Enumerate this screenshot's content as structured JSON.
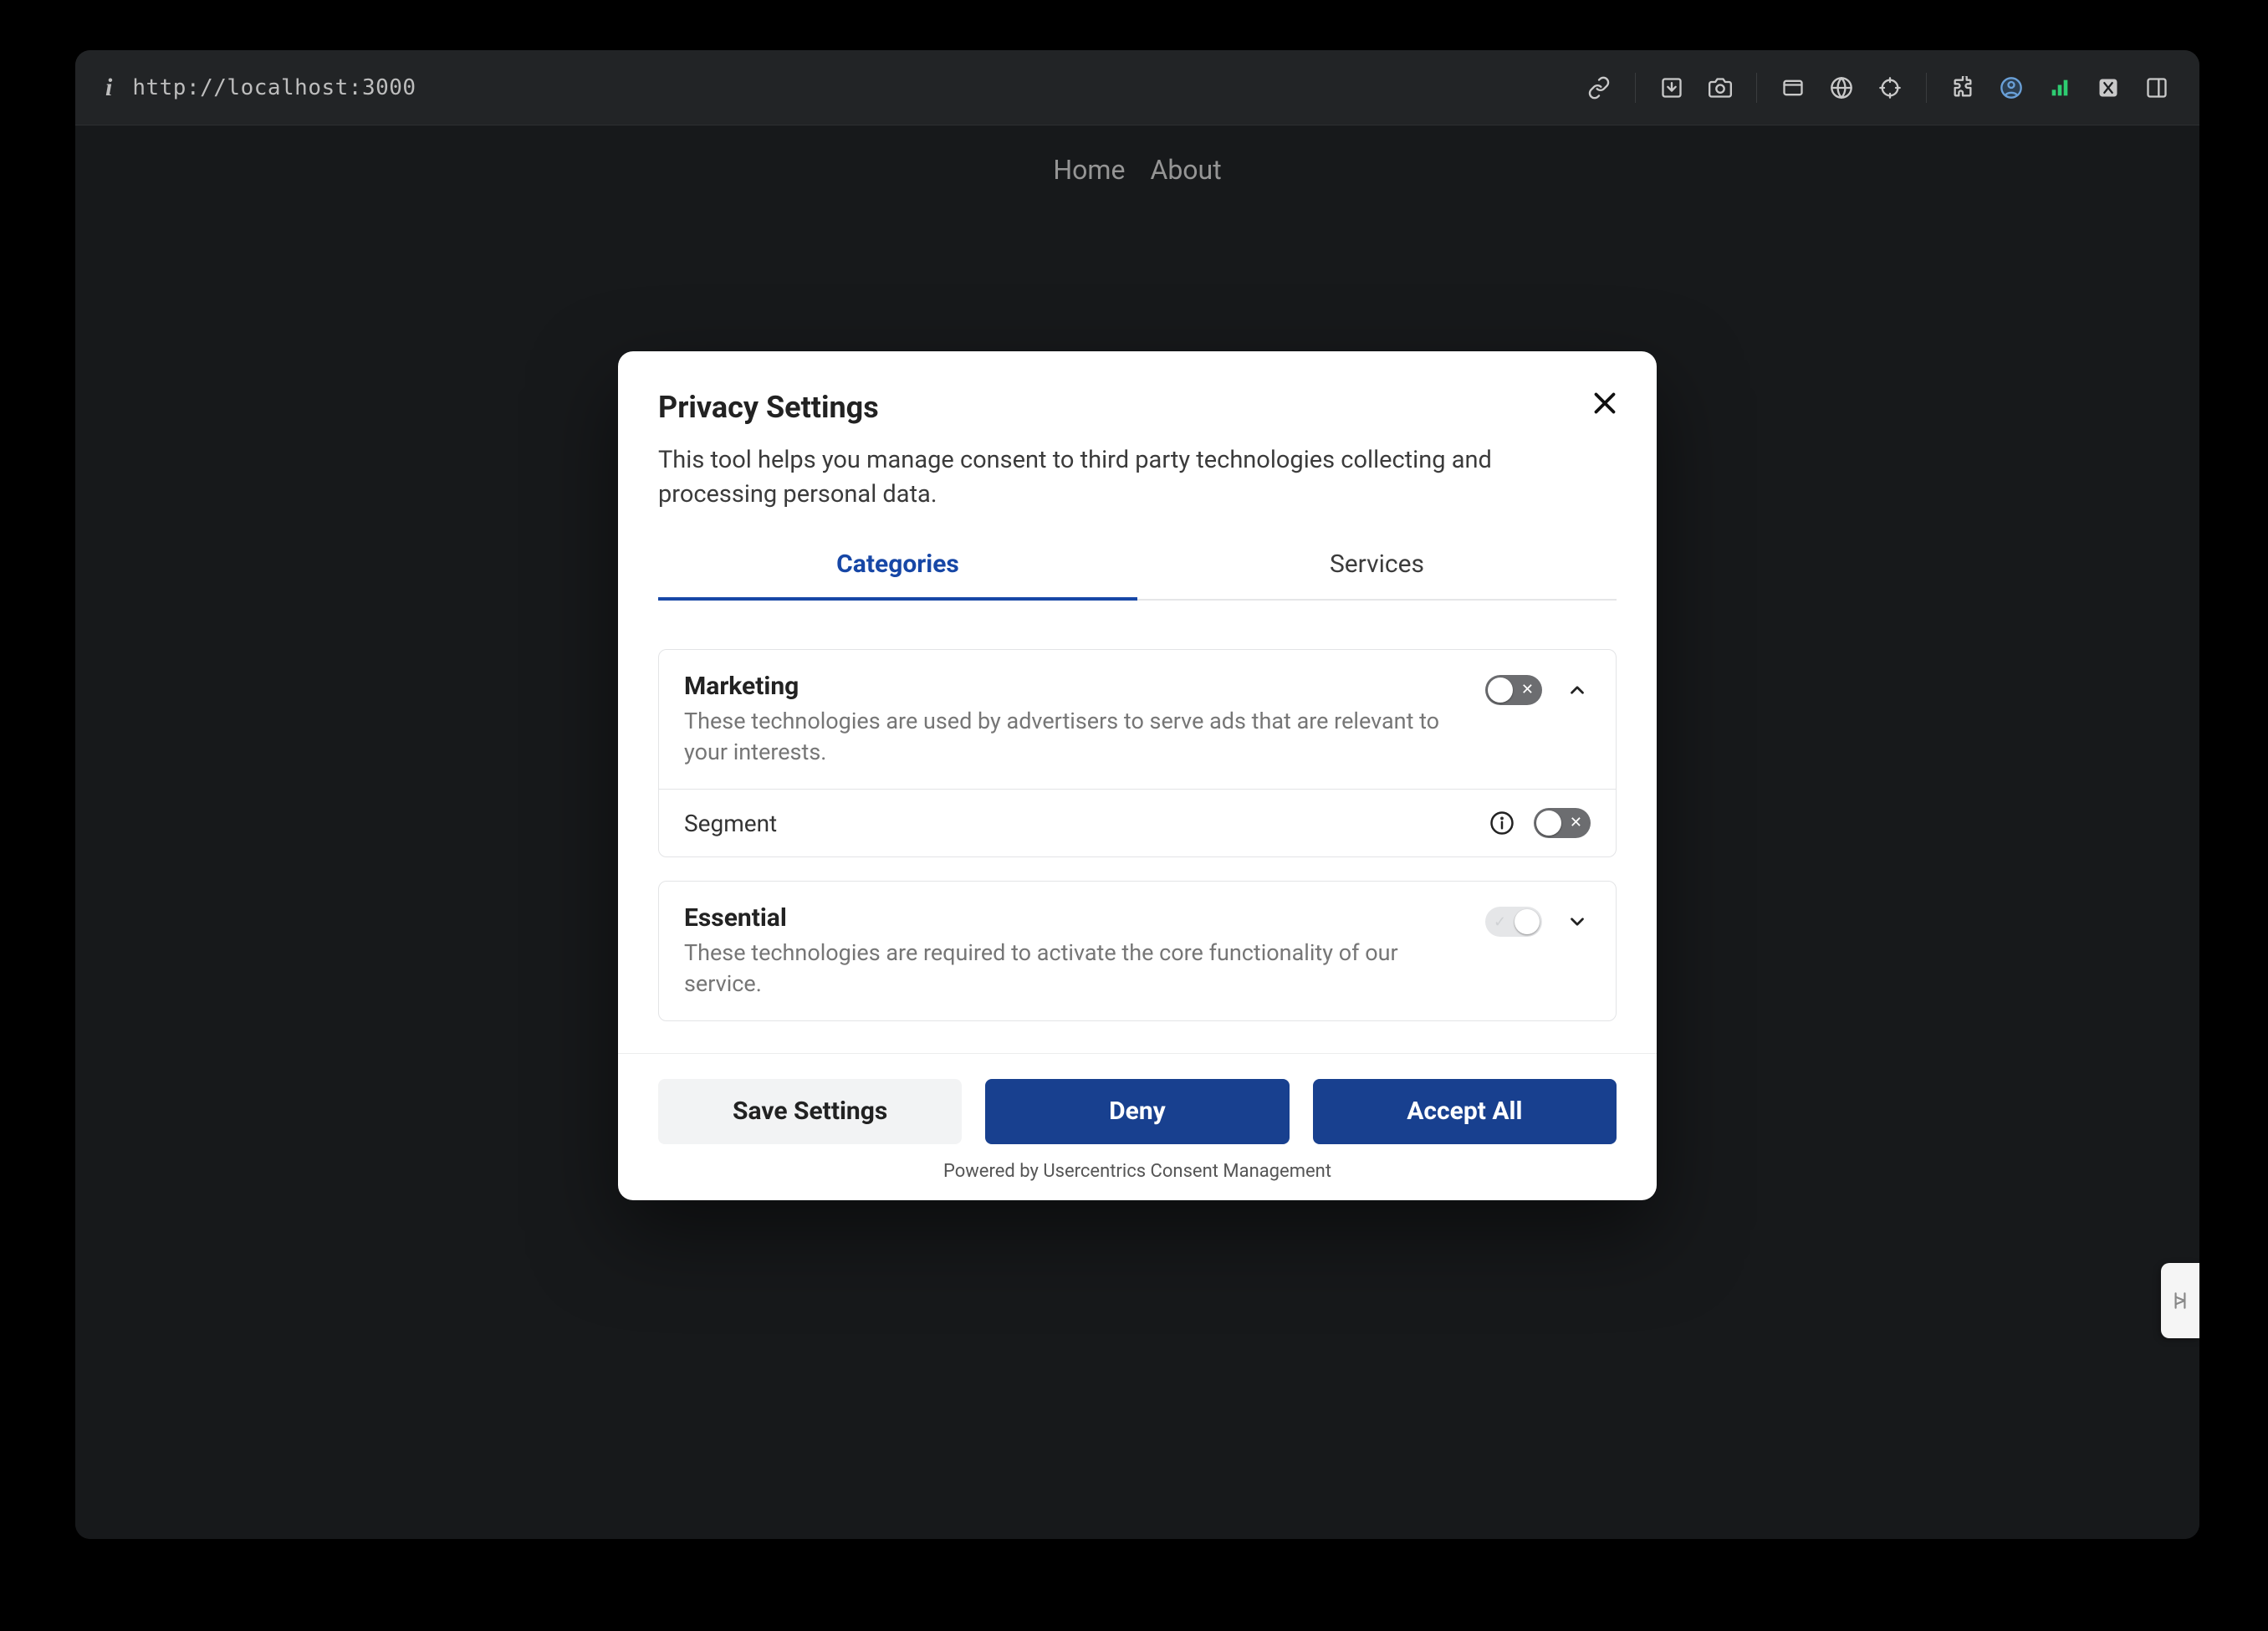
{
  "browser": {
    "url": "http://localhost:3000"
  },
  "nav": {
    "home": "Home",
    "about": "About"
  },
  "modal": {
    "title": "Privacy Settings",
    "description": "This tool helps you manage consent to third party technologies collecting and processing personal data.",
    "tabs": {
      "categories": "Categories",
      "services": "Services"
    },
    "categories": [
      {
        "title": "Marketing",
        "description": "These technologies are used by advertisers to serve ads that are relevant to your interests.",
        "expanded": true,
        "toggle_on": false,
        "locked": false,
        "services": [
          {
            "name": "Segment",
            "toggle_on": false
          }
        ]
      },
      {
        "title": "Essential",
        "description": "These technologies are required to activate the core functionality of our service.",
        "expanded": false,
        "toggle_on": true,
        "locked": true,
        "services": []
      }
    ],
    "buttons": {
      "save": "Save Settings",
      "deny": "Deny",
      "accept": "Accept All"
    },
    "powered_prefix": "Powered by ",
    "powered_link": "Usercentrics Consent Management"
  }
}
